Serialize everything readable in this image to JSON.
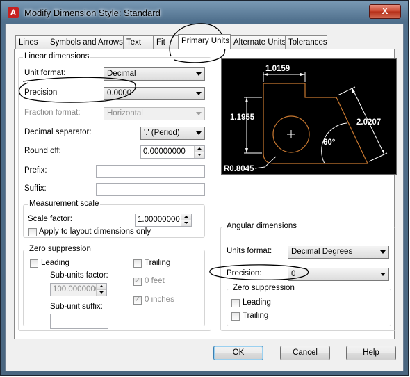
{
  "window": {
    "title": "Modify Dimension Style: Standard",
    "close_glyph": "X",
    "app_icon_glyph": "A"
  },
  "tabs": [
    {
      "label": "Lines"
    },
    {
      "label": "Symbols and Arrows"
    },
    {
      "label": "Text"
    },
    {
      "label": "Fit"
    },
    {
      "label": "Primary Units",
      "active": true
    },
    {
      "label": "Alternate Units"
    },
    {
      "label": "Tolerances"
    }
  ],
  "linear": {
    "legend": "Linear dimensions",
    "unit_format_label": "Unit format:",
    "unit_format": "Decimal",
    "precision_label": "Precision",
    "precision": "0.0000",
    "fraction_format_label": "Fraction format:",
    "fraction_format": "Horizontal",
    "decimal_sep_label": "Decimal separator:",
    "decimal_sep": "'.' (Period)",
    "round_off_label": "Round off:",
    "round_off": "0.00000000",
    "prefix_label": "Prefix:",
    "prefix": "",
    "suffix_label": "Suffix:",
    "suffix": ""
  },
  "measurement": {
    "legend": "Measurement scale",
    "scale_factor_label": "Scale factor:",
    "scale_factor": "1.00000000",
    "apply_layout_label": "Apply to layout dimensions only"
  },
  "zero_linear": {
    "legend": "Zero suppression",
    "leading_label": "Leading",
    "trailing_label": "Trailing",
    "subunits_factor_label": "Sub-units factor:",
    "subunits_factor": "100.0000000",
    "zero_feet_label": "0 feet",
    "zero_inches_label": "0 inches",
    "subunit_suffix_label": "Sub-unit suffix:",
    "subunit_suffix": ""
  },
  "preview": {
    "dim_top": "1.0159",
    "dim_left": "1.1955",
    "dim_right": "2.0207",
    "angle": "60°",
    "radius": "R0.8045"
  },
  "angular": {
    "legend": "Angular dimensions",
    "units_format_label": "Units format:",
    "units_format": "Decimal Degrees",
    "precision_label": "Precision:",
    "precision": "0",
    "zero_legend": "Zero suppression",
    "leading_label": "Leading",
    "trailing_label": "Trailing"
  },
  "buttons": {
    "ok": "OK",
    "cancel": "Cancel",
    "help": "Help"
  },
  "colors": {
    "preview_bg": "#000000",
    "preview_geometry": "#c87830",
    "dim_lines": "#ffffff",
    "titlebar": "#5a7a98"
  }
}
